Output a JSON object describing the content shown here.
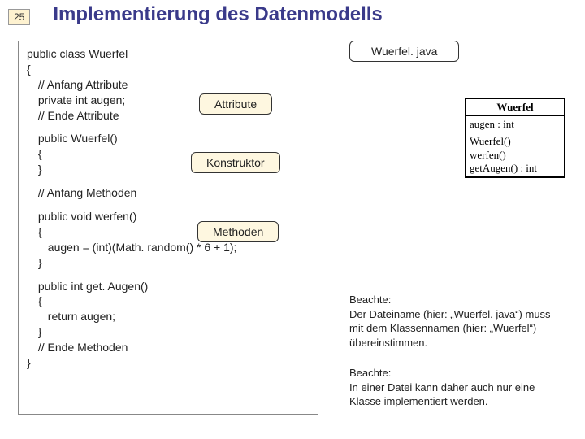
{
  "slide": {
    "number": "25",
    "title": "Implementierung des Datenmodells"
  },
  "file_label": "Wuerfel. java",
  "labels": {
    "attr": "Attribute",
    "ctor": "Konstruktor",
    "meth": "Methoden"
  },
  "code": {
    "l1": "public class Wuerfel",
    "l2": "{",
    "l3": " // Anfang Attribute",
    "l4": " private int augen;",
    "l5": " // Ende Attribute",
    "l6": " public Wuerfel()",
    "l7": " {",
    "l8": " }",
    "l9": " // Anfang Methoden",
    "l10": " public void werfen()",
    "l11": " {",
    "l12": "  augen = (int)(Math. random() * 6 + 1);",
    "l13": " }",
    "l14": " public int get. Augen()",
    "l15": " {",
    "l16": "  return augen;",
    "l17": " }",
    "l18": " // Ende Methoden",
    "l19": "}"
  },
  "uml": {
    "name": "Wuerfel",
    "attr1": "augen : int",
    "op1": "Wuerfel()",
    "op2": "werfen()",
    "op3": "getAugen() : int"
  },
  "note1": {
    "lead": "Beachte:",
    "body": "Der Dateiname (hier: „Wuerfel. java“) muss mit dem Klassennamen (hier: „Wuerfel“) übereinstimmen."
  },
  "note2": {
    "lead": "Beachte:",
    "body": "In einer Datei kann daher auch nur eine Klasse implementiert werden."
  }
}
